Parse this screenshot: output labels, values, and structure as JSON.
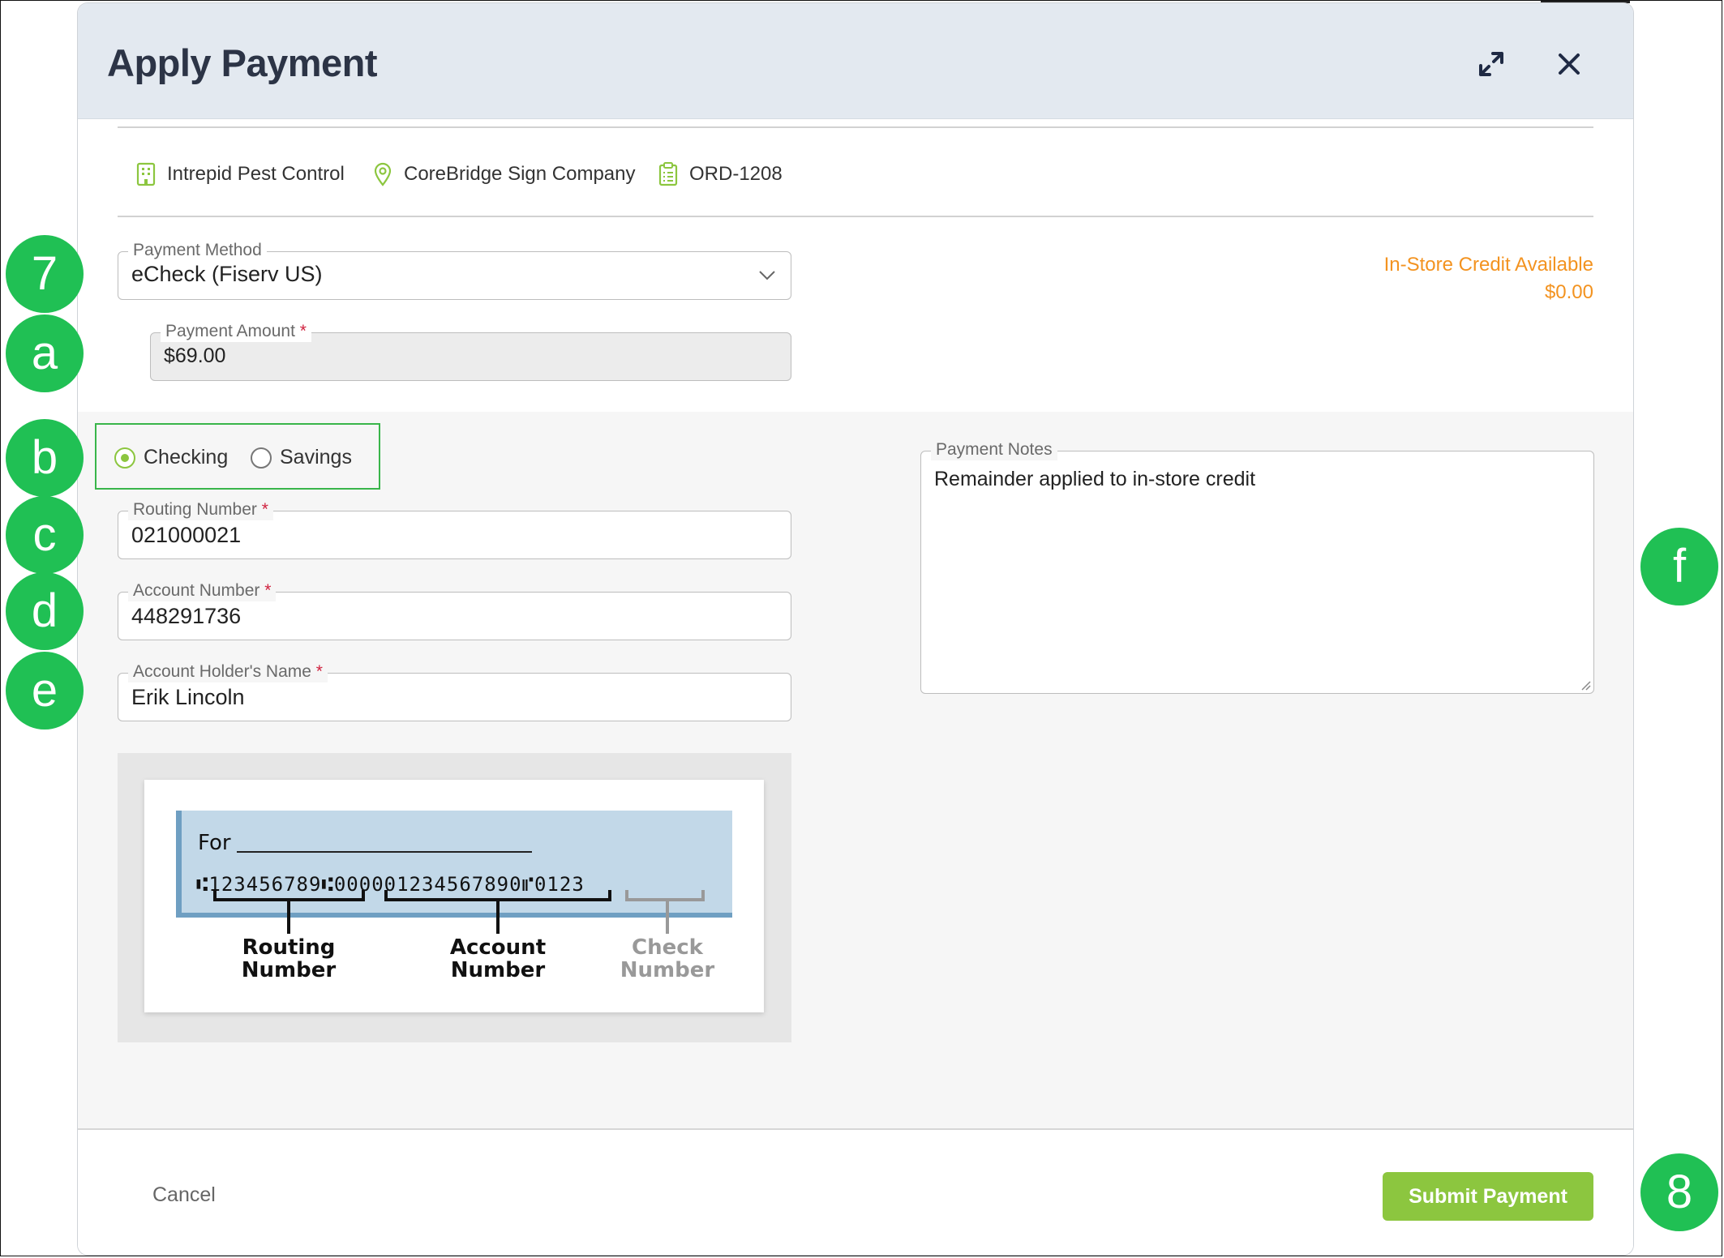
{
  "dialog": {
    "title": "Apply Payment",
    "expand_icon": "expand-arrows-icon",
    "close_icon": "close-icon"
  },
  "context": {
    "company": "Intrepid Pest Control",
    "location": "CoreBridge Sign Company",
    "order": "ORD-1208"
  },
  "payment_method": {
    "label": "Payment Method",
    "value": "eCheck (Fiserv US)"
  },
  "in_store_credit": {
    "label": "In-Store Credit Available",
    "amount": "$0.00",
    "color": "#f39320"
  },
  "payment_amount": {
    "label": "Payment Amount",
    "required": "*",
    "value": "$69.00"
  },
  "account_type": {
    "options": [
      "Checking",
      "Savings"
    ],
    "selected": "Checking"
  },
  "routing_number": {
    "label": "Routing Number",
    "required": "*",
    "value": "021000021"
  },
  "account_number": {
    "label": "Account Number",
    "required": "*",
    "value": "448291736"
  },
  "account_holder": {
    "label": "Account Holder's Name",
    "required": "*",
    "value": "Erik Lincoln"
  },
  "payment_notes": {
    "label": "Payment Notes",
    "value": "Remainder applied to in-store credit"
  },
  "check_diagram": {
    "for_label": "For",
    "micr_line": "⑆123456789⑆000001234567890⑈0123",
    "routing_label_1": "Routing",
    "routing_label_2": "Number",
    "account_label_1": "Account",
    "account_label_2": "Number",
    "check_label_1": "Check",
    "check_label_2": "Number"
  },
  "footer": {
    "cancel": "Cancel",
    "submit": "Submit Payment"
  },
  "callouts": [
    "7",
    "a",
    "b",
    "c",
    "d",
    "e",
    "f",
    "8"
  ],
  "colors": {
    "accent_green": "#8cc63f",
    "callout_green": "#20c054",
    "header_bg": "#e3e9f0",
    "required_red": "#d0223f"
  }
}
